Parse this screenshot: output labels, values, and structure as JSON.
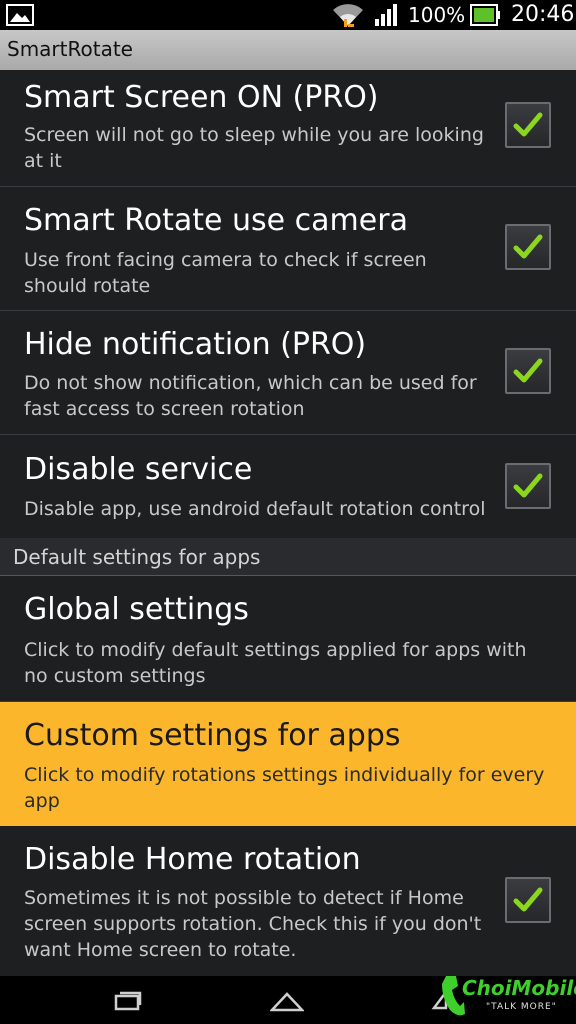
{
  "status_bar": {
    "battery_percent": "100%",
    "time": "20:46",
    "icons": [
      "picture-icon",
      "wifi-icon",
      "signal-icon",
      "battery-icon"
    ]
  },
  "app_bar": {
    "title": "SmartRotate"
  },
  "preferences": [
    {
      "title": "Smart Screen ON (PRO)",
      "summary": "Screen will not go to sleep while you are looking at it",
      "checked": true
    },
    {
      "title": "Smart Rotate use camera",
      "summary": "Use front facing camera to check if screen should rotate",
      "checked": true
    },
    {
      "title": "Hide notification (PRO)",
      "summary": "Do not show notification, which can be used for fast access to screen rotation",
      "checked": true
    },
    {
      "title": "Disable service",
      "summary": "Disable app, use android default rotation control",
      "checked": true
    }
  ],
  "category": {
    "label": "Default settings for apps"
  },
  "app_preferences": [
    {
      "title": "Global settings",
      "summary": "Click to modify default settings applied for apps with no custom settings"
    },
    {
      "title": "Custom settings for apps",
      "summary": "Click to modify rotations settings individually for every app",
      "highlighted": true
    },
    {
      "title": "Disable Home rotation",
      "summary": "Sometimes it is not possible to detect if Home screen supports rotation. Check this if you don't want Home screen to rotate.",
      "checked": true
    }
  ],
  "watermark": {
    "text": "ChoiMobile",
    "tagline": "\"TALK MORE\""
  },
  "colors": {
    "highlight": "#fbb62c",
    "check": "#8cd61e",
    "background": "#1e1f21"
  }
}
